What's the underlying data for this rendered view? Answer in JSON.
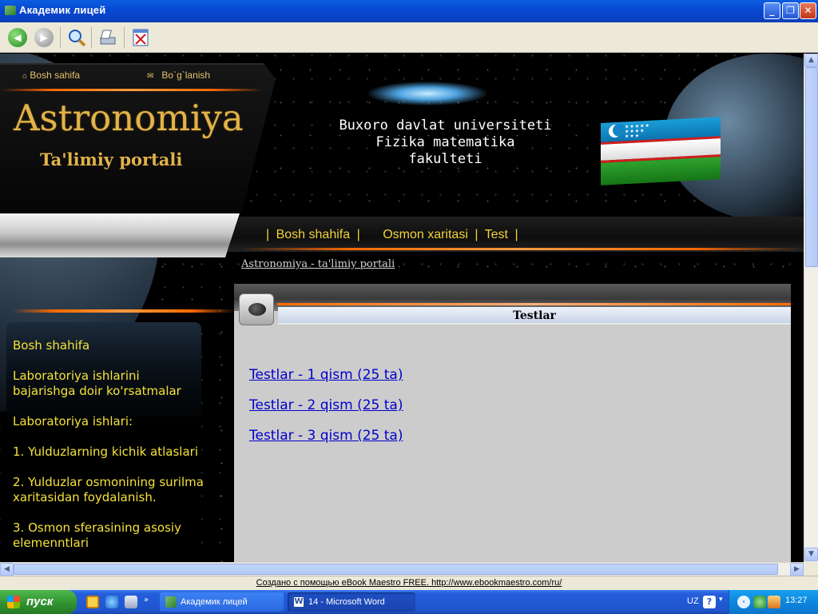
{
  "window": {
    "title": "Академик лицей"
  },
  "toolbar": {
    "back_icon": "back-arrow-icon",
    "forward_icon": "forward-arrow-icon",
    "search_icon": "magnifier-icon",
    "print_icon": "print-icon",
    "close_icon": "close-book-icon"
  },
  "header": {
    "home_link": "Bosh sahifa",
    "contact_link": "Bo`g`lanish",
    "logo_title": "Astronomiya",
    "logo_subtitle": "Ta'limiy portali",
    "university_lines": [
      "Buxoro davlat universiteti",
      "Fizika matematika",
      "fakulteti"
    ]
  },
  "menu": {
    "items": [
      "Bosh shahifa",
      "Osmon xaritasi",
      "Test"
    ],
    "separator": "|"
  },
  "breadcrumb": "Astronomiya - ta'limiy portali",
  "sidebar": {
    "items": [
      "Bosh shahifa",
      "Laboratoriya ishlarini bajarishga doir ko'rsatmalar",
      "Laboratoriya ishlari:",
      "1. Yulduzlarning kichik atlaslari",
      "2. Yulduzlar osmonining surilma xaritasidan foydalanish.",
      "3. Osmon sferasining asosiy elemenntlari"
    ]
  },
  "panel": {
    "title": "Testlar",
    "links": [
      "Testlar - 1 qism (25 ta)",
      "Testlar - 2 qism (25 ta)",
      "Testlar - 3 qism (25 ta)"
    ]
  },
  "statusbar": {
    "text": "Создано с помощью eBook Maestro FREE. http://www.ebookmaestro.com/ru/"
  },
  "taskbar": {
    "start_label": "пуск",
    "tasks": [
      "Академик лицей",
      "14 - Microsoft Word"
    ],
    "language": "UZ",
    "clock": "13:27"
  },
  "colors": {
    "menu_text": "#f2d33a",
    "logo_gold": "#e2b34a",
    "link": "#0000cc",
    "accent_orange": "#ff6a00"
  }
}
